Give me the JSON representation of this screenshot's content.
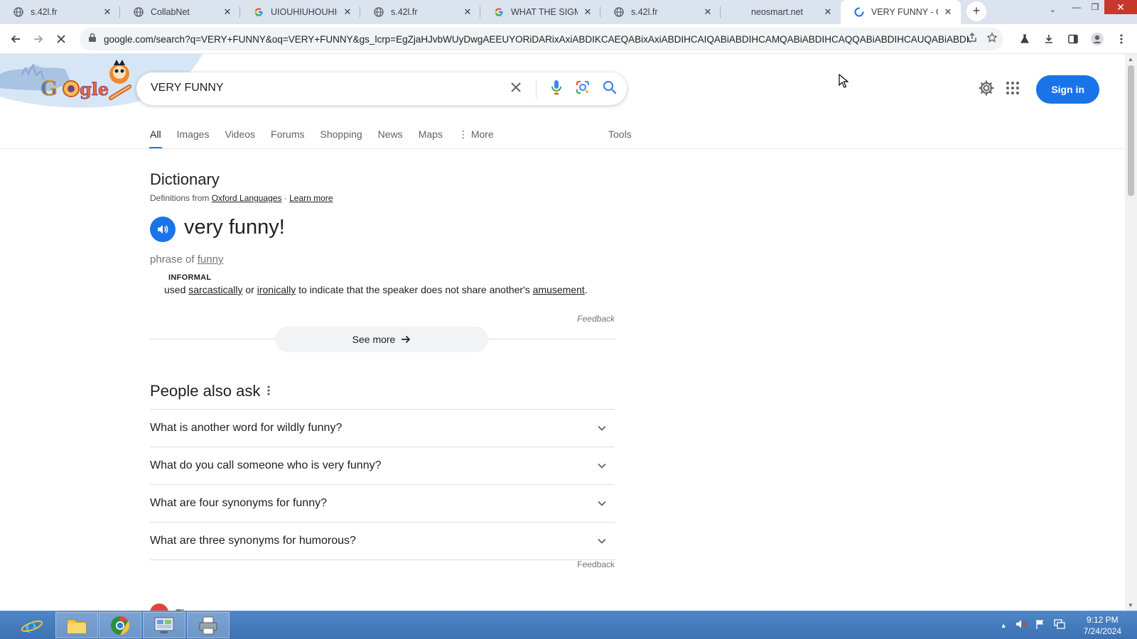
{
  "browser": {
    "tabs": [
      {
        "title": "s.42l.fr",
        "favicon": "globe-icon",
        "active": false
      },
      {
        "title": "CollabNet",
        "favicon": "globe-icon",
        "active": false
      },
      {
        "title": "UIOUHIUHOUHIOH",
        "favicon": "google-g-icon",
        "active": false
      },
      {
        "title": "s.42l.fr",
        "favicon": "globe-icon",
        "active": false
      },
      {
        "title": "WHAT THE SIGMA",
        "favicon": "google-g-icon",
        "active": false
      },
      {
        "title": "s.42l.fr",
        "favicon": "globe-icon",
        "active": false
      },
      {
        "title": "neosmart.net",
        "favicon": "none",
        "active": false
      },
      {
        "title": "VERY FUNNY - Goo",
        "favicon": "loading-icon",
        "active": true
      }
    ],
    "url": "google.com/search?q=VERY+FUNNY&oq=VERY+FUNNY&gs_lcrp=EgZjaHJvbWUyDwgAEEUYORiDARixAxiABDIKCAEQABixAxiABDIHCAIQABiABDIHCAMQABiABDIHCAQQABiABDIHCAUQABiABDI..."
  },
  "google": {
    "search_query": "VERY FUNNY",
    "sign_in_label": "Sign in",
    "tabs": [
      "All",
      "Images",
      "Videos",
      "Forums",
      "Shopping",
      "News",
      "Maps",
      "More"
    ],
    "tools_label": "Tools"
  },
  "dictionary": {
    "title": "Dictionary",
    "source_prefix": "Definitions from ",
    "source_name": "Oxford Languages",
    "separator": " · ",
    "learn_more": "Learn more",
    "headword": "very funny!",
    "phrase_prefix": "phrase of ",
    "phrase_link": "funny",
    "register": "INFORMAL",
    "definition": {
      "p1": "used ",
      "w1": "sarcastically",
      "p2": " or ",
      "w2": "ironically",
      "p3": " to indicate that the speaker does not share another's ",
      "w3": "amusement",
      "p4": "."
    },
    "feedback": "Feedback",
    "see_more": "See more"
  },
  "people_also_ask": {
    "title": "People also ask",
    "questions": [
      "What is another word for wildly funny?",
      "What do you call someone who is very funny?",
      "What are four synonyms for funny?",
      "What are three synonyms for humorous?"
    ],
    "feedback": "Feedback"
  },
  "next_result": {
    "site": "Thesaurus.com"
  },
  "taskbar": {
    "time": "9:12 PM",
    "date": "7/24/2024"
  },
  "colors": {
    "accent_blue": "#1a73e8",
    "tab_strip": "#dbe3ef",
    "taskbar": "#4a7fc1"
  }
}
